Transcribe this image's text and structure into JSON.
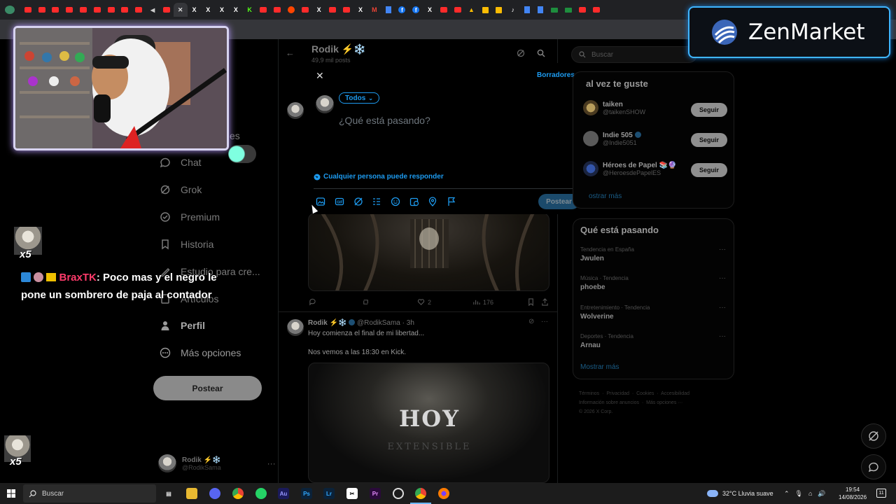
{
  "browser": {
    "tabs": [
      "yt",
      "yt",
      "yt",
      "yt",
      "yt",
      "yt",
      "yt",
      "yt",
      "yt",
      "snd",
      "yt",
      "active",
      "x",
      "x",
      "x",
      "x",
      "k",
      "yt",
      "yt",
      "rd",
      "yt",
      "x",
      "yt",
      "yt",
      "x",
      "gm",
      "doc",
      "fb",
      "fb",
      "x",
      "yt",
      "yt",
      "dr",
      "sh",
      "sh",
      "tt",
      "doc",
      "doc",
      "g",
      "g",
      "yt",
      "yt"
    ]
  },
  "left_nav": {
    "items": [
      {
        "label": "Chat",
        "icon": "chat-icon"
      },
      {
        "label": "Grok",
        "icon": "grok-icon"
      },
      {
        "label": "Premium",
        "icon": "premium-icon"
      },
      {
        "label": "Historia",
        "icon": "bookmark-icon"
      },
      {
        "label": "Estudio para cre...",
        "icon": "studio-icon"
      },
      {
        "label": "Artículos",
        "icon": "articles-icon"
      },
      {
        "label": "Perfil",
        "icon": "profile-icon"
      },
      {
        "label": "Más opciones",
        "icon": "more-icon"
      }
    ],
    "partial_label": "es",
    "post_button": "Postear",
    "account": {
      "name": "Rodik ⚡❄️",
      "handle": "@RodikSama"
    }
  },
  "timeline": {
    "title": "Rodik ⚡❄️",
    "subtitle": "49,9 mil posts",
    "post1_stats": {
      "likes": "2",
      "views": "176"
    },
    "post2": {
      "author": "Rodik ⚡❄️",
      "meta": "@RodikSama · 3h",
      "line1": "Hoy comienza el final de mi libertad...",
      "line2": "Nos vemos a las 18:30 en Kick.",
      "image_title": "HOY",
      "image_sub": "EXTENSIBLE"
    }
  },
  "modal": {
    "drafts": "Borradores",
    "audience": "Todos",
    "placeholder": "¿Qué está pasando?",
    "reply_setting": "Cualquier persona puede responder",
    "post_button": "Postear"
  },
  "right": {
    "search_placeholder": "Buscar",
    "who_to_follow_title": "al vez te guste",
    "follow": [
      {
        "name": "taiken",
        "handle": "@taikenSHOW",
        "button": "Seguir"
      },
      {
        "name": "Indie 505",
        "handle": "@Indie5051",
        "button": "Seguir"
      },
      {
        "name": "Héroes de Papel 📚🔮",
        "handle": "@HeroesdePapelES",
        "button": "Seguir"
      }
    ],
    "show_more_follow": "ostrar más",
    "trends_title": "Qué está pasando",
    "trends": [
      {
        "context": "Tendencia en España",
        "name": "Jwulen"
      },
      {
        "context": "Música · Tendencia",
        "name": "phoebe"
      },
      {
        "context": "Entretenimiento · Tendencia",
        "name": "Wolverine"
      },
      {
        "context": "Deportes · Tendencia",
        "name": "Arnau"
      }
    ],
    "show_more_trends": "Mostrar más",
    "footer": [
      "Términos",
      "Privacidad",
      "Cookies",
      "Accesibilidad",
      "Información sobre anuncios",
      "Más opciones ···",
      "© 2026 X Corp."
    ]
  },
  "overlay": {
    "brand": "ZenMarket",
    "chat_user": "BraxTK",
    "chat_text": ": Poco mas y el negro le pone un sombrero de paja al contador",
    "multiplier": "x5"
  },
  "taskbar": {
    "search": "Buscar",
    "weather": "32°C  Lluvia suave",
    "time": "19:54",
    "date": "14/08/2026",
    "notifications": "11",
    "apps": [
      "Au",
      "Ps",
      "Lr",
      "Pr"
    ]
  },
  "colors": {
    "accent": "#1d9bf0",
    "zen_border": "#3fb6ff",
    "chat_user": "#ff3b6b"
  }
}
